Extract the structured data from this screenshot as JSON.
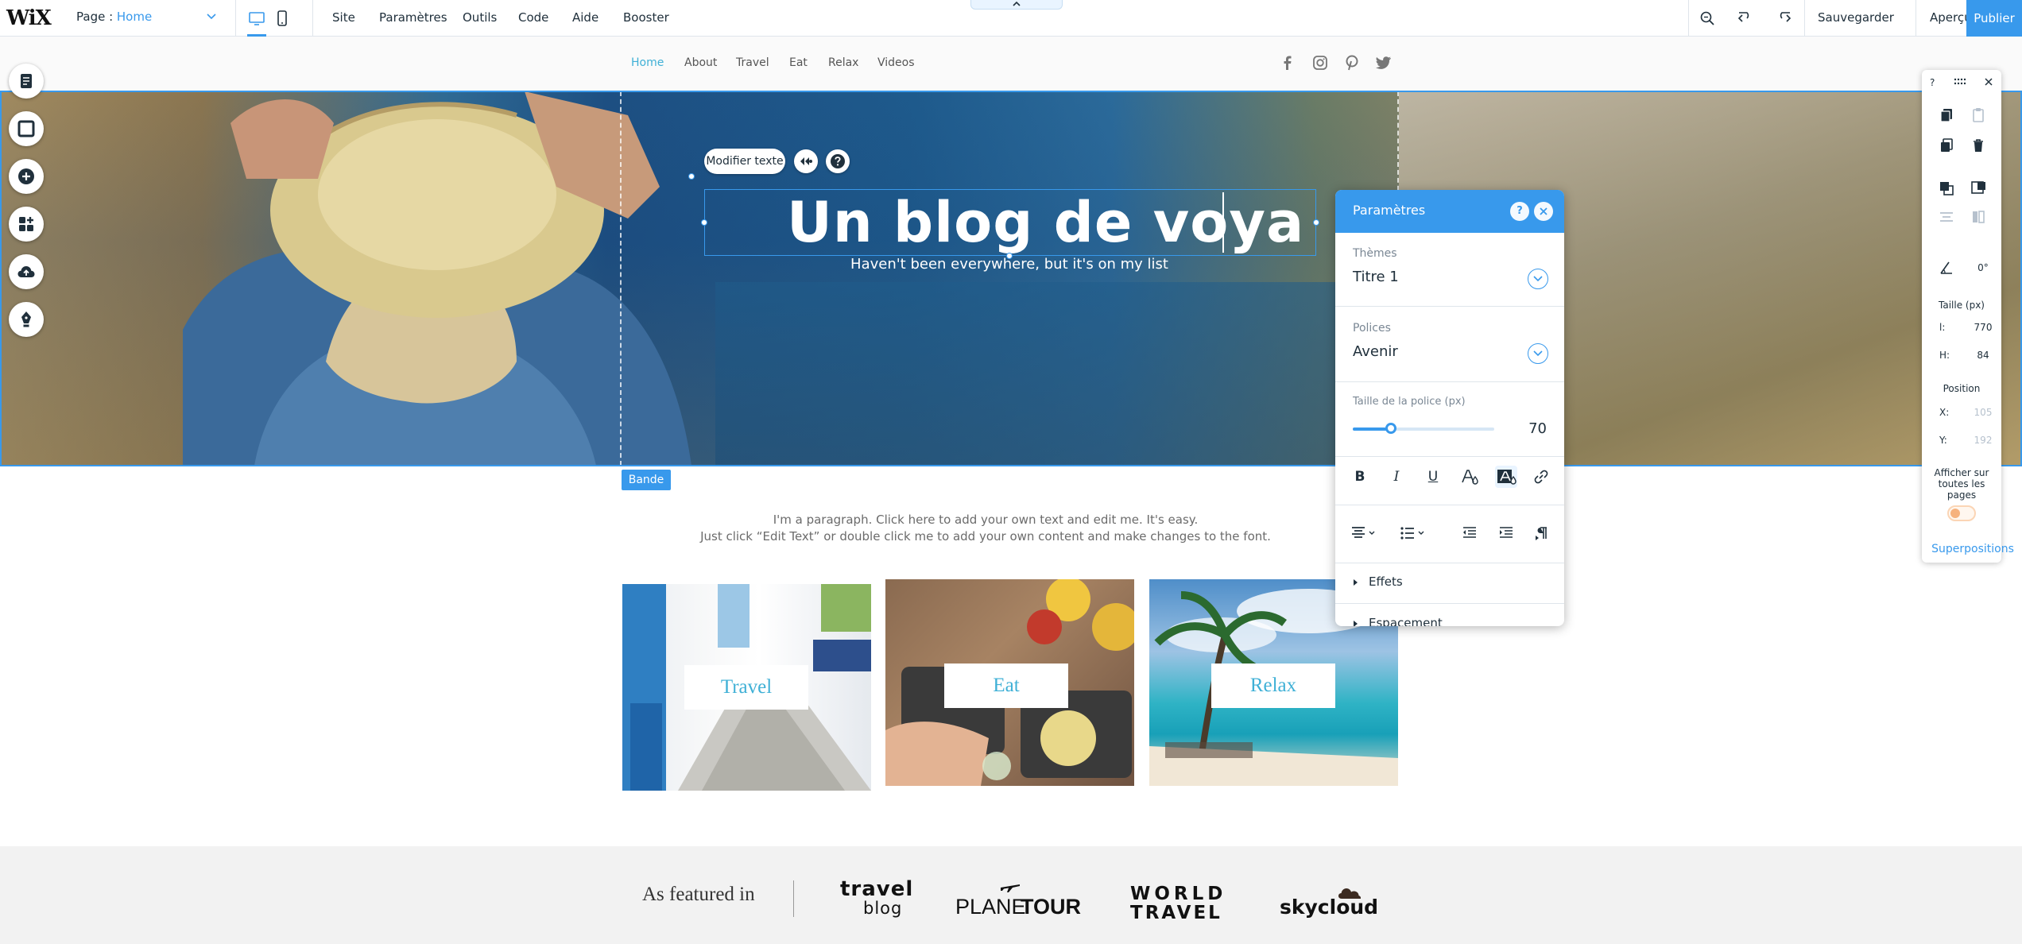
{
  "topbar": {
    "logo": "WiX",
    "page_label": "Page : ",
    "page_value": "Home",
    "menu": [
      "Site",
      "Paramètres",
      "Outils",
      "Code",
      "Aide",
      "Booster"
    ],
    "save": "Sauvegarder",
    "preview": "Aperçu",
    "publish": "Publier"
  },
  "site": {
    "nav": [
      "Home",
      "About",
      "Travel",
      "Eat",
      "Relax",
      "Videos"
    ],
    "social_icons": [
      "facebook-icon",
      "instagram-icon",
      "pinterest-icon",
      "twitter-icon"
    ]
  },
  "hero": {
    "title": "Un blog de voya",
    "subtitle": "Haven't been everywhere, but it's on my list",
    "edit_text_button": "Modifier texte",
    "strip_badge": "Bande"
  },
  "content": {
    "paragraph_line1": "I'm a paragraph. Click here to add your own text and edit me. It's easy.",
    "paragraph_line2": "Just click “Edit Text” or double click me to add your own content and make changes to the font.",
    "tiles": [
      "Travel",
      "Eat",
      "Relax"
    ]
  },
  "featured": {
    "label": "As featured in",
    "logos": {
      "travel_blog_top": "travel",
      "travel_blog_bottom": "blog",
      "planetour_a": "PLANE",
      "planetour_b": "TOUR",
      "world_travel_top": "WORLD",
      "world_travel_bottom": "TRAVEL",
      "skycloud": "skycloud"
    }
  },
  "settings_panel": {
    "title": "Paramètres",
    "themes_label": "Thèmes",
    "themes_value": "Titre 1",
    "fonts_label": "Polices",
    "fonts_value": "Avenir",
    "font_size_label": "Taille de la police (px)",
    "font_size_value": "70",
    "font_size_fraction": 0.27,
    "effects_label": "Effets",
    "spacing_label": "Espacement"
  },
  "inspector": {
    "rotation": "0°",
    "size_label": "Taille (px)",
    "width_label": "l:",
    "width_value": "770",
    "height_label": "H:",
    "height_value": "84",
    "position_label": "Position",
    "x_label": "X:",
    "x_value": "105",
    "y_label": "Y:",
    "y_value": "192",
    "show_all_pages_1": "Afficher sur",
    "show_all_pages_2": "toutes les",
    "show_all_pages_3": "pages",
    "layers_link": "Superpositions"
  },
  "colors": {
    "accent": "#3899ec",
    "nav_active": "#3fb0d6",
    "tile_label": "#3fb0d6",
    "toggle": "#f6b27e"
  }
}
